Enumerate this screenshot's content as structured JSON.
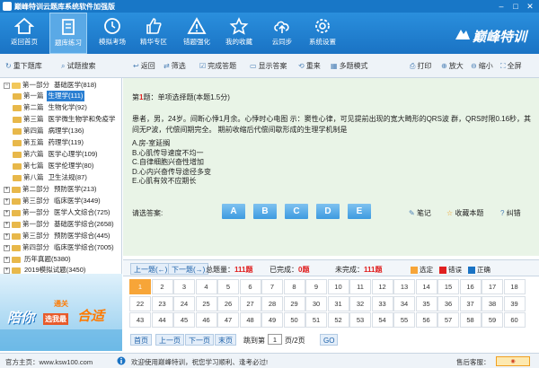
{
  "window": {
    "title": "巅峰特训云题库系统软件加强版"
  },
  "main_toolbar": {
    "items": [
      {
        "label": "返回首页",
        "icon": "home-icon"
      },
      {
        "label": "题库练习",
        "icon": "document-icon",
        "active": true
      },
      {
        "label": "模拟考场",
        "icon": "clock-icon"
      },
      {
        "label": "精华专区",
        "icon": "thumb-up-icon"
      },
      {
        "label": "错题强化",
        "icon": "warning-icon"
      },
      {
        "label": "我的收藏",
        "icon": "star-icon"
      },
      {
        "label": "云同步",
        "icon": "cloud-upload-icon"
      },
      {
        "label": "系统设置",
        "icon": "gear-icon"
      }
    ],
    "brand": "巅峰特训"
  },
  "sub_toolbar": {
    "reload": "重下题库",
    "search": "试题搜索",
    "back": "返回",
    "filter": "筛选",
    "finish": "完成答题",
    "show_answer": "显示答案",
    "redo": "重来",
    "multi": "多题模式",
    "print": "打印",
    "zoom_in": "放大",
    "zoom_out": "缩小",
    "fullscreen": "全屏"
  },
  "tree": {
    "part1": {
      "label": "第一部分",
      "name": "基础医学(818)"
    },
    "chapters": [
      {
        "chap": "第一篇",
        "name": "生理学(111)",
        "selected": true
      },
      {
        "chap": "第二篇",
        "name": "生物化学(92)"
      },
      {
        "chap": "第三篇",
        "name": "医学微生物学和免疫学"
      },
      {
        "chap": "第四篇",
        "name": "病理学(136)"
      },
      {
        "chap": "第五篇",
        "name": "药理学(119)"
      },
      {
        "chap": "第六篇",
        "name": "医学心理学(109)"
      },
      {
        "chap": "第七篇",
        "name": "医学伦理学(80)"
      },
      {
        "chap": "第八篇",
        "name": "卫生法规(87)"
      }
    ],
    "parts": [
      {
        "label": "第二部分",
        "name": "预防医学(213)"
      },
      {
        "label": "第三部分",
        "name": "临床医学(3449)"
      },
      {
        "label": "第一部分",
        "name": "医学人文综合(725)"
      },
      {
        "label": "第一部分",
        "name": "基础医学综合(2658)"
      },
      {
        "label": "第三部分",
        "name": "预防医学综合(445)"
      },
      {
        "label": "第四部分",
        "name": "临床医学综合(7005)"
      },
      {
        "label": "",
        "name": "历年真题(5380)"
      },
      {
        "label": "",
        "name": "2019模拟试题(3450)"
      }
    ]
  },
  "ad": {
    "t1": "陪你",
    "t2": "通关",
    "t3": "选我最",
    "t4": "合适"
  },
  "question": {
    "num": "1",
    "head_suffix": "题：单项选择题(本题1.5分)",
    "body": "患者，男，24岁。间断心悸1月余。心悸时心电图 示：窦性心律，可见提前出现的宽大畸形的QRS波 群，QRS时限0.16秒，其间无P波，代偿间期完全。 期前收缩后代偿间歇形成的生理学机制是",
    "options": [
      "A.房-室延搁",
      "B.心肌传导速度不均一",
      "C.自律细胞兴奋性增加",
      "D.心内兴奋传导途径多变",
      "E.心肌有效不应期长"
    ],
    "answer_label": "请选答案:",
    "answer_buttons": [
      "A",
      "B",
      "C",
      "D",
      "E"
    ],
    "note": "笔记",
    "favorite": "收藏本题",
    "error": "纠错"
  },
  "nav": {
    "prev": "上一题(←)",
    "next": "下一题(→)",
    "total_label": "总题量：",
    "total": "111题",
    "done_label": "已完成：",
    "done": "0题",
    "undone_label": "未完成：",
    "undone": "111题",
    "legend": [
      {
        "label": "选定",
        "color": "#f7a538"
      },
      {
        "label": "错误",
        "color": "#e02020"
      },
      {
        "label": "正确",
        "color": "#1a73c4"
      }
    ]
  },
  "grid_numbers": [
    [
      "1",
      "2",
      "3",
      "4",
      "5",
      "6",
      "7",
      "8",
      "9",
      "10",
      "11",
      "12",
      "13",
      "14",
      "15",
      "16",
      "17",
      "18"
    ],
    [
      "22",
      "23",
      "24",
      "25",
      "26",
      "27",
      "28",
      "29",
      "30",
      "31",
      "32",
      "33",
      "34",
      "35",
      "36",
      "37",
      "38",
      "39"
    ],
    [
      "43",
      "44",
      "45",
      "46",
      "47",
      "48",
      "49",
      "50",
      "51",
      "52",
      "53",
      "54",
      "55",
      "56",
      "57",
      "58",
      "59",
      "60"
    ]
  ],
  "pager": {
    "first": "首页",
    "prev": "上一页",
    "next": "下一页",
    "last": "末页",
    "jump": "跳到第",
    "page": "1",
    "total": "页/2页",
    "go": "GO"
  },
  "statusbar": {
    "site": "官方主页：www.ksw100.com",
    "welcome": "欢迎使用巅峰特训，祝您学习顺利、逢考必过!",
    "service": "售后客服："
  }
}
